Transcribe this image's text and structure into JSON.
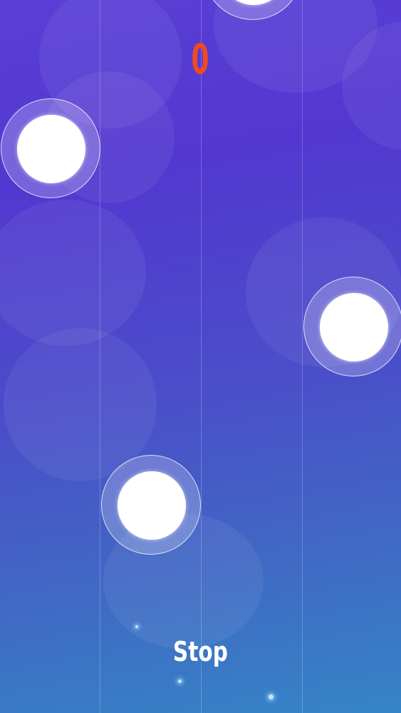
{
  "score": {
    "value": "0",
    "color": "#f04a1e"
  },
  "footer": {
    "song_title": "Stop"
  },
  "tiles": [
    {
      "name": "tile-lane-3-top",
      "lane": 3
    },
    {
      "name": "tile-lane-1",
      "lane": 1
    },
    {
      "name": "tile-lane-4",
      "lane": 4
    },
    {
      "name": "tile-lane-2",
      "lane": 2
    }
  ],
  "lanes": 4,
  "colors": {
    "background_top": "#5a3fd6",
    "background_bottom": "#3585c6",
    "tile_core": "#ffffff"
  }
}
